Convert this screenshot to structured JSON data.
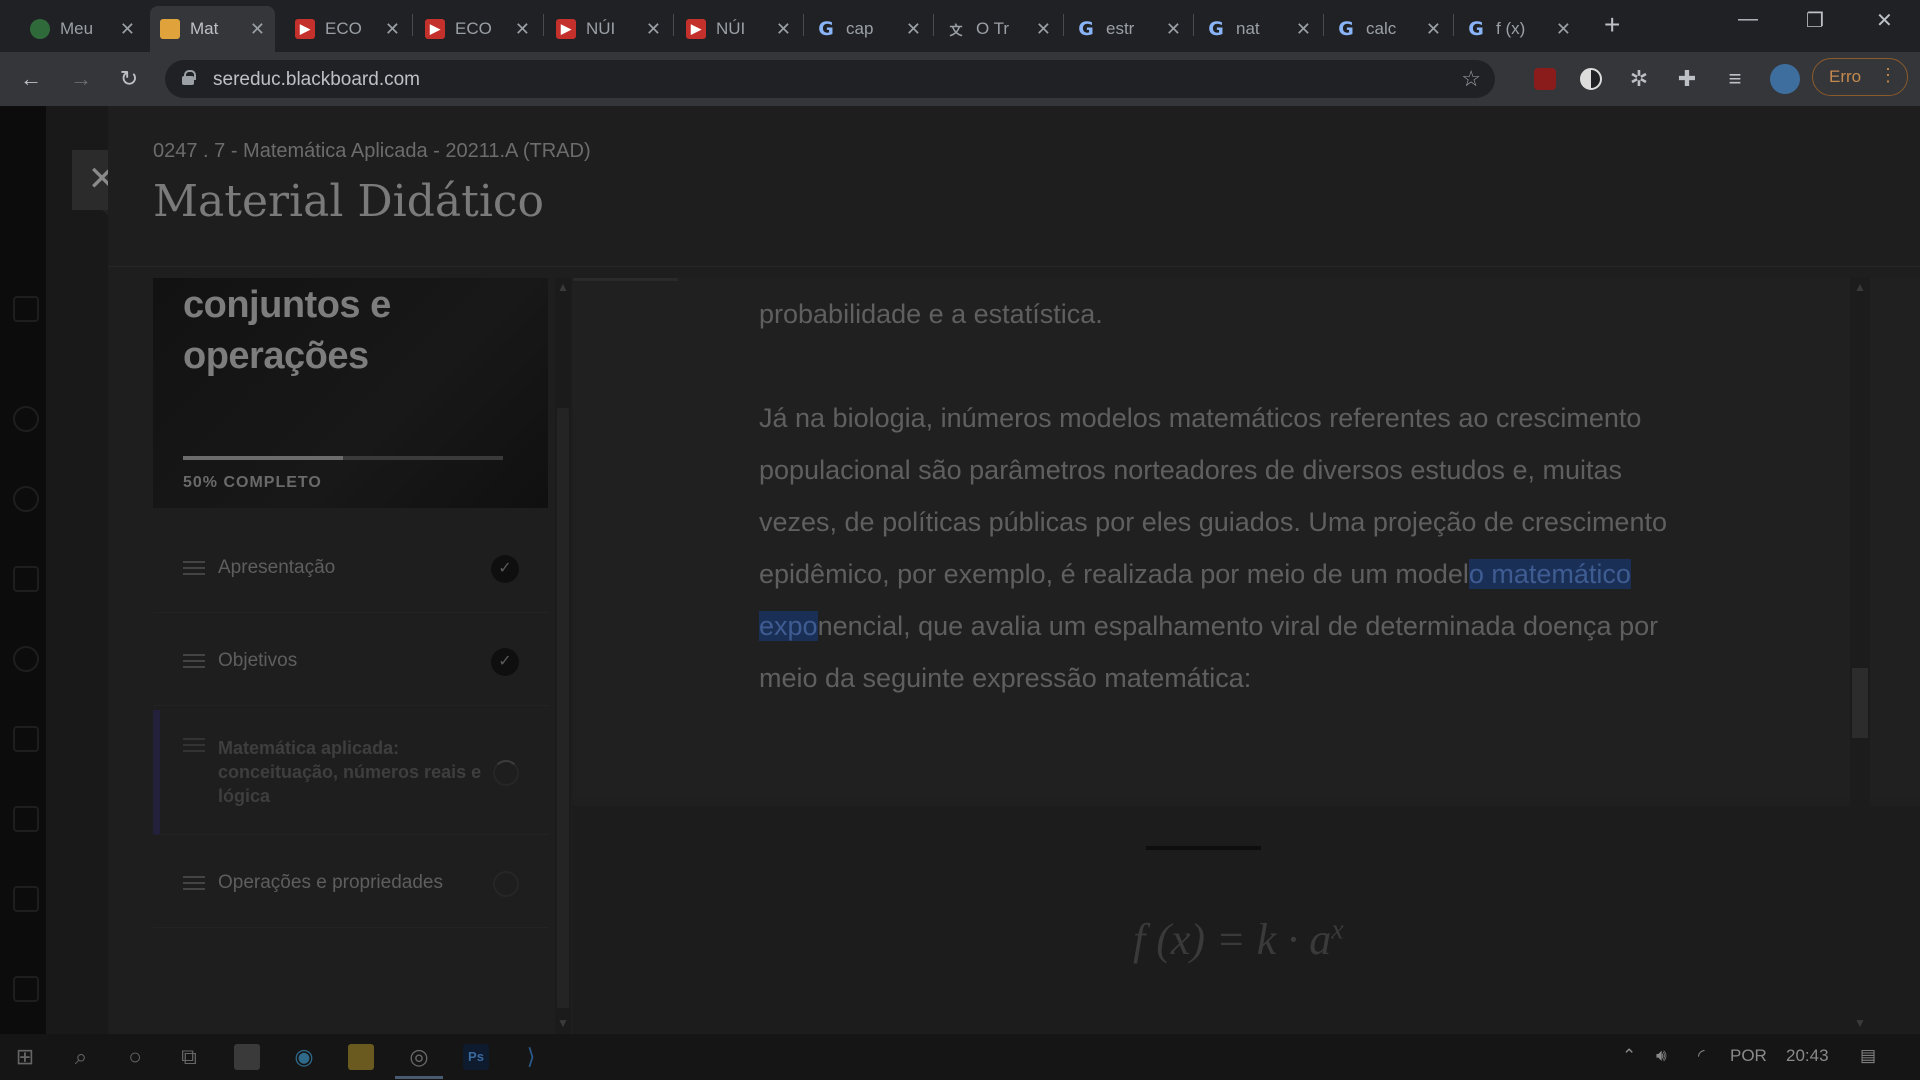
{
  "browser": {
    "tabs": [
      {
        "title": "Meu",
        "icon": "meu-icon"
      },
      {
        "title": "Mat",
        "icon": "blackboard-icon",
        "active": true
      },
      {
        "title": "ECO",
        "icon": "youtube-icon"
      },
      {
        "title": "ECO",
        "icon": "youtube-icon"
      },
      {
        "title": "NÚI",
        "icon": "youtube-icon"
      },
      {
        "title": "NÚI",
        "icon": "youtube-icon"
      },
      {
        "title": "cap",
        "icon": "google-icon"
      },
      {
        "title": "O Tr",
        "icon": "translate-icon"
      },
      {
        "title": "estr",
        "icon": "google-icon"
      },
      {
        "title": "nat",
        "icon": "google-icon"
      },
      {
        "title": "calc",
        "icon": "google-icon"
      },
      {
        "title": "f (x)",
        "icon": "google-icon"
      }
    ],
    "url": "sereduc.blackboard.com",
    "profile_status": "Erro"
  },
  "page": {
    "course": "0247 . 7 - Matemática Aplicada - 20211.A (TRAD)",
    "title": "Material Didático"
  },
  "sidebar": {
    "hero_title": "conjuntos e operações",
    "progress_label": "50% COMPLETO",
    "progress": 0.5,
    "items": [
      {
        "label": "Apresentação",
        "status": "done"
      },
      {
        "label": "Objetivos",
        "status": "done"
      },
      {
        "label": "Matemática aplicada: conceituação, números reais e lógica",
        "status": "in-progress"
      },
      {
        "label": "Operações e propriedades",
        "status": "pending"
      }
    ]
  },
  "content": {
    "para1": "probabilidade e a estatística.",
    "para2_before": "Já na biologia, inúmeros modelos matemáticos referentes ao crescimento populacional são parâmetros norteadores de diversos estudos e, muitas vezes, de políticas públicas por eles guiados. Uma projeção de crescimento epidêmico, por exemplo, é realizada por meio de um model",
    "para2_highlight": "o matemático expo",
    "para2_after": "nencial, que avalia um espalhamento viral de determinada doença por meio da seguinte expressão matemática:",
    "formula_base": "f (x) = k · a",
    "formula_exp": "x"
  },
  "taskbar": {
    "language": "POR",
    "time": "20:43"
  }
}
